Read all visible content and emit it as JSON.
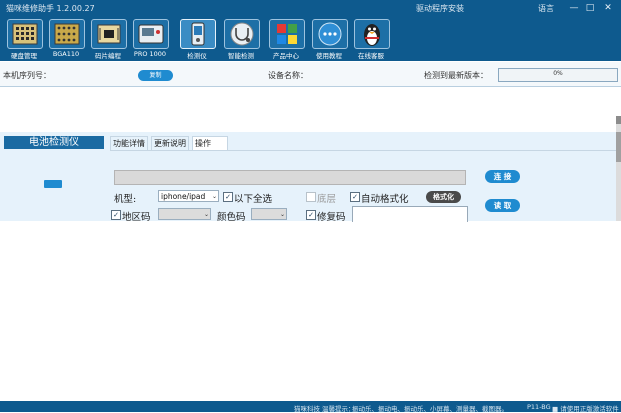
{
  "window": {
    "title": "猫咪维修助手 1.2.00.27",
    "driver_install": "驱动程序安装",
    "language": "语言",
    "minimize": "—",
    "maximize": "□",
    "close": "✕"
  },
  "toolbar": {
    "items": [
      {
        "label": "硬盘管理",
        "icon": "chip-icon"
      },
      {
        "label": "BGA110",
        "icon": "bga-chip-icon"
      },
      {
        "label": "码片编程",
        "icon": "programmer-icon"
      },
      {
        "label": "PRO 1000",
        "icon": "pro-device-icon"
      },
      {
        "label": "检测仪",
        "icon": "battery-tester-icon"
      },
      {
        "label": "智能检测",
        "icon": "stethoscope-icon"
      },
      {
        "label": "产品中心",
        "icon": "apps-icon"
      },
      {
        "label": "使用教程",
        "icon": "chat-icon"
      },
      {
        "label": "在线客服",
        "icon": "penguin-icon"
      }
    ]
  },
  "info": {
    "serial_label": "本机序列号：",
    "copy_button": "复制",
    "device_name_label": "设备名称：",
    "latest_version_label": "检测到最新版本：",
    "progress_percent": 0,
    "progress_text": "0%"
  },
  "side": {
    "title": "电池检测仪"
  },
  "tabs": [
    {
      "label": "功能详情",
      "active": false
    },
    {
      "label": "更新说明",
      "active": false
    },
    {
      "label": "操作",
      "active": true
    }
  ],
  "operation": {
    "model_label": "机型:",
    "model_value": "iphone/ipad",
    "select_all_label": "以下全选",
    "bottom_layer_label": "底层",
    "auto_format_label": "自动格式化",
    "format_button": "格式化",
    "connect_button": "连 接",
    "read_button": "读 取",
    "region_code_label": "地区码",
    "color_code_label": "颜色码",
    "repair_code_label": "修复码",
    "select_arrow": "⌄"
  },
  "status": {
    "company": "猫咪科技",
    "tips": "温馨提示：",
    "links": "振动乐、振动电、振动乐、小屏幕、测量器、截图器。",
    "version": "P11-BG",
    "software": "■ 请使用正版激活软件"
  },
  "colors": {
    "accent": "#0e5a8e",
    "button": "#1f8bd0"
  }
}
